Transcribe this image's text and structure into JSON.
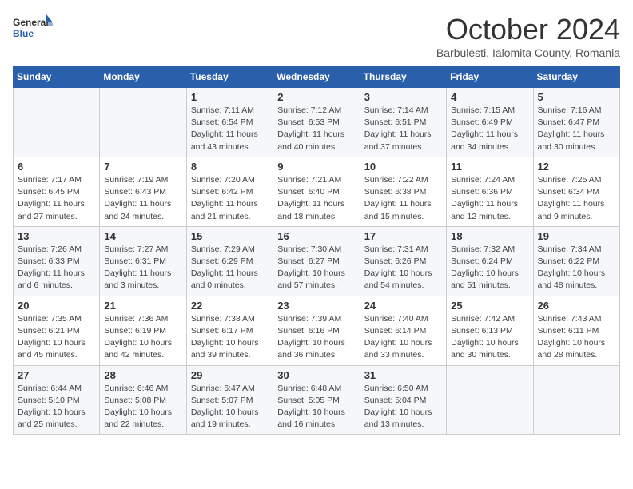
{
  "logo": {
    "general": "General",
    "blue": "Blue"
  },
  "title": {
    "month": "October 2024",
    "location": "Barbulesti, Ialomita County, Romania"
  },
  "days_of_week": [
    "Sunday",
    "Monday",
    "Tuesday",
    "Wednesday",
    "Thursday",
    "Friday",
    "Saturday"
  ],
  "weeks": [
    [
      null,
      null,
      {
        "day": 1,
        "sunrise": "7:11 AM",
        "sunset": "6:54 PM",
        "daylight": "11 hours and 43 minutes."
      },
      {
        "day": 2,
        "sunrise": "7:12 AM",
        "sunset": "6:53 PM",
        "daylight": "11 hours and 40 minutes."
      },
      {
        "day": 3,
        "sunrise": "7:14 AM",
        "sunset": "6:51 PM",
        "daylight": "11 hours and 37 minutes."
      },
      {
        "day": 4,
        "sunrise": "7:15 AM",
        "sunset": "6:49 PM",
        "daylight": "11 hours and 34 minutes."
      },
      {
        "day": 5,
        "sunrise": "7:16 AM",
        "sunset": "6:47 PM",
        "daylight": "11 hours and 30 minutes."
      }
    ],
    [
      {
        "day": 6,
        "sunrise": "7:17 AM",
        "sunset": "6:45 PM",
        "daylight": "11 hours and 27 minutes."
      },
      {
        "day": 7,
        "sunrise": "7:19 AM",
        "sunset": "6:43 PM",
        "daylight": "11 hours and 24 minutes."
      },
      {
        "day": 8,
        "sunrise": "7:20 AM",
        "sunset": "6:42 PM",
        "daylight": "11 hours and 21 minutes."
      },
      {
        "day": 9,
        "sunrise": "7:21 AM",
        "sunset": "6:40 PM",
        "daylight": "11 hours and 18 minutes."
      },
      {
        "day": 10,
        "sunrise": "7:22 AM",
        "sunset": "6:38 PM",
        "daylight": "11 hours and 15 minutes."
      },
      {
        "day": 11,
        "sunrise": "7:24 AM",
        "sunset": "6:36 PM",
        "daylight": "11 hours and 12 minutes."
      },
      {
        "day": 12,
        "sunrise": "7:25 AM",
        "sunset": "6:34 PM",
        "daylight": "11 hours and 9 minutes."
      }
    ],
    [
      {
        "day": 13,
        "sunrise": "7:26 AM",
        "sunset": "6:33 PM",
        "daylight": "11 hours and 6 minutes."
      },
      {
        "day": 14,
        "sunrise": "7:27 AM",
        "sunset": "6:31 PM",
        "daylight": "11 hours and 3 minutes."
      },
      {
        "day": 15,
        "sunrise": "7:29 AM",
        "sunset": "6:29 PM",
        "daylight": "11 hours and 0 minutes."
      },
      {
        "day": 16,
        "sunrise": "7:30 AM",
        "sunset": "6:27 PM",
        "daylight": "10 hours and 57 minutes."
      },
      {
        "day": 17,
        "sunrise": "7:31 AM",
        "sunset": "6:26 PM",
        "daylight": "10 hours and 54 minutes."
      },
      {
        "day": 18,
        "sunrise": "7:32 AM",
        "sunset": "6:24 PM",
        "daylight": "10 hours and 51 minutes."
      },
      {
        "day": 19,
        "sunrise": "7:34 AM",
        "sunset": "6:22 PM",
        "daylight": "10 hours and 48 minutes."
      }
    ],
    [
      {
        "day": 20,
        "sunrise": "7:35 AM",
        "sunset": "6:21 PM",
        "daylight": "10 hours and 45 minutes."
      },
      {
        "day": 21,
        "sunrise": "7:36 AM",
        "sunset": "6:19 PM",
        "daylight": "10 hours and 42 minutes."
      },
      {
        "day": 22,
        "sunrise": "7:38 AM",
        "sunset": "6:17 PM",
        "daylight": "10 hours and 39 minutes."
      },
      {
        "day": 23,
        "sunrise": "7:39 AM",
        "sunset": "6:16 PM",
        "daylight": "10 hours and 36 minutes."
      },
      {
        "day": 24,
        "sunrise": "7:40 AM",
        "sunset": "6:14 PM",
        "daylight": "10 hours and 33 minutes."
      },
      {
        "day": 25,
        "sunrise": "7:42 AM",
        "sunset": "6:13 PM",
        "daylight": "10 hours and 30 minutes."
      },
      {
        "day": 26,
        "sunrise": "7:43 AM",
        "sunset": "6:11 PM",
        "daylight": "10 hours and 28 minutes."
      }
    ],
    [
      {
        "day": 27,
        "sunrise": "6:44 AM",
        "sunset": "5:10 PM",
        "daylight": "10 hours and 25 minutes."
      },
      {
        "day": 28,
        "sunrise": "6:46 AM",
        "sunset": "5:08 PM",
        "daylight": "10 hours and 22 minutes."
      },
      {
        "day": 29,
        "sunrise": "6:47 AM",
        "sunset": "5:07 PM",
        "daylight": "10 hours and 19 minutes."
      },
      {
        "day": 30,
        "sunrise": "6:48 AM",
        "sunset": "5:05 PM",
        "daylight": "10 hours and 16 minutes."
      },
      {
        "day": 31,
        "sunrise": "6:50 AM",
        "sunset": "5:04 PM",
        "daylight": "10 hours and 13 minutes."
      },
      null,
      null
    ]
  ],
  "labels": {
    "sunrise": "Sunrise:",
    "sunset": "Sunset:",
    "daylight": "Daylight hours"
  }
}
